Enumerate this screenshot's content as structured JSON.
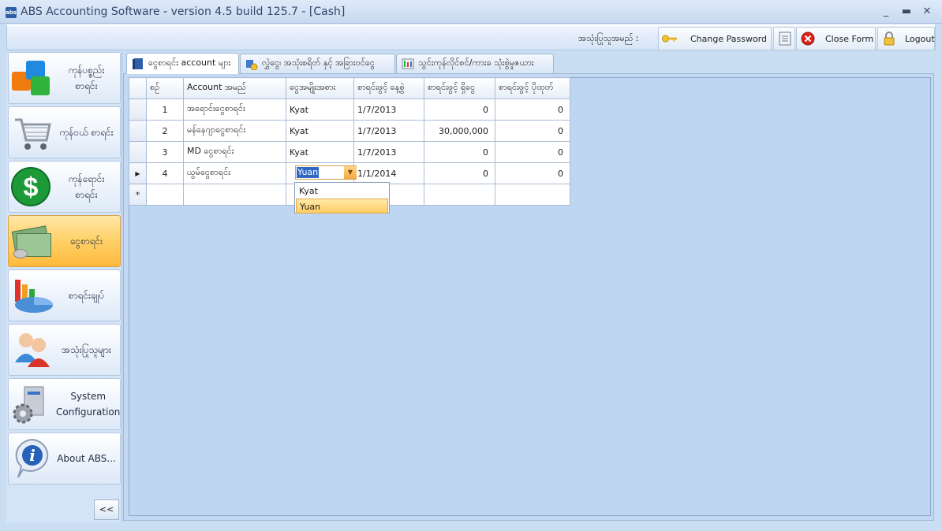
{
  "window": {
    "title": "ABS Accounting Software - version 4.5 build 125.7 - [Cash]",
    "logo_text": "abs"
  },
  "toolbar": {
    "user_label": "အသုံးပြုသူအမည် :",
    "buttons": [
      {
        "label": "Change Password",
        "icon": "key-icon"
      },
      {
        "label": "",
        "icon": "document-icon"
      },
      {
        "label": "Close Form",
        "icon": "close-icon"
      },
      {
        "label": "Logout",
        "icon": "lock-icon"
      }
    ]
  },
  "sidebar": {
    "items": [
      {
        "label": "ကုန်ပစ္စည်း စာရင်း",
        "icon": "cubes-icon"
      },
      {
        "label": "ကုန်ဝယ် စာရင်း",
        "icon": "cart-icon"
      },
      {
        "label": "ကုန်ရောင်း စာရင်း",
        "icon": "dollar-icon"
      },
      {
        "label": "ငွေစာရင်း",
        "icon": "money-icon",
        "active": true
      },
      {
        "label": "စာရင်းချုပ်",
        "icon": "chart-icon"
      },
      {
        "label": "အသုံးပြုသူများ",
        "icon": "users-icon"
      },
      {
        "label": "System Configuration",
        "icon": "gear-icon"
      },
      {
        "label": "About ABS...",
        "icon": "info-icon"
      }
    ],
    "collapse_label": "<<"
  },
  "tabs": [
    {
      "label": "ငွေစာရင်း account များ",
      "active": true
    },
    {
      "label": "လွှဲငွေ၊ အသုံးစရိတ် နှင့် အခြားဝင်ငွေ"
    },
    {
      "label": "သွင်းကုန်လိုင်စင်/ကားခ သုံးစွဲမှုဇယား"
    }
  ],
  "grid": {
    "columns": [
      "စဉ်",
      "Account အမည်",
      "ငွေအမျိုးအစား",
      "စာရင်းဖွင့် နေ့စွဲ",
      "စာရင်းဖွင့် ရှိငွေ",
      "စာရင်းဖွင့် ပိုထုတ်"
    ],
    "rows": [
      {
        "no": "1",
        "name": "အရောင်းငွေစာရင်း",
        "currency": "Kyat",
        "date": "1/7/2013",
        "opening": "0",
        "overdraft": "0"
      },
      {
        "no": "2",
        "name": "မန်နေဂျာငွေစာရင်း",
        "currency": "Kyat",
        "date": "1/7/2013",
        "opening": "30,000,000",
        "overdraft": "0"
      },
      {
        "no": "3",
        "name": "MD ငွေစာရင်း",
        "currency": "Kyat",
        "date": "1/7/2013",
        "opening": "0",
        "overdraft": "0"
      },
      {
        "no": "4",
        "name": "ယွမ်ငွေစာရင်း",
        "currency": "Yuan",
        "date": "1/1/2014",
        "opening": "0",
        "overdraft": "0"
      }
    ],
    "current_row_marker": "▶",
    "new_row_marker": "*"
  },
  "dropdown": {
    "value": "Yuan",
    "options": [
      "Kyat",
      "Yuan"
    ],
    "selected": "Yuan"
  }
}
